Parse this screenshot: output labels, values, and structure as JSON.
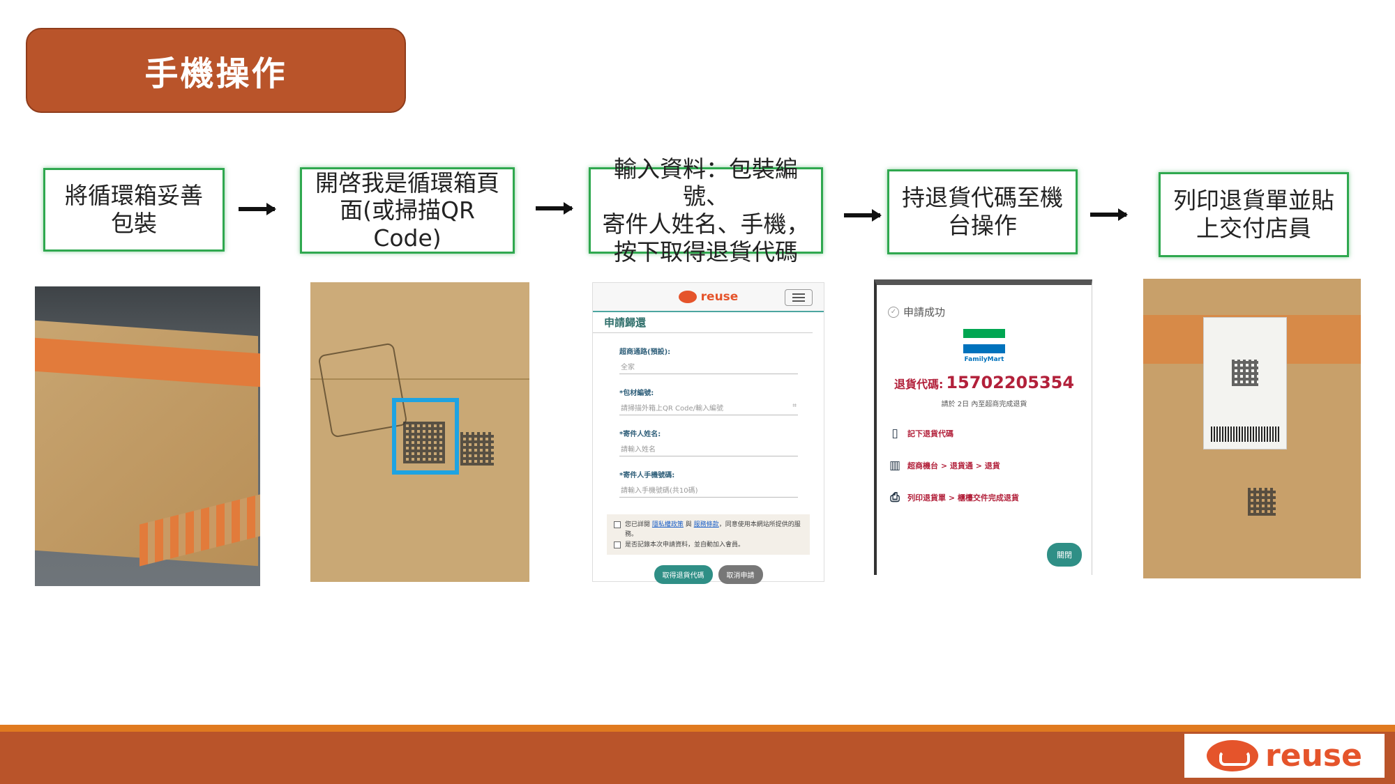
{
  "title": "手機操作",
  "steps": [
    {
      "label": "將循環箱妥善\n包裝"
    },
    {
      "label": "開啓我是循環箱頁\n面(或掃描QR\nCode)"
    },
    {
      "label": "輸入資料：包裝編號、\n寄件人姓名、手機，\n按下取得退貨代碼"
    },
    {
      "label": "持退貨代碼至機\n台操作"
    },
    {
      "label": "列印退貨單並貼\n上交付店員"
    }
  ],
  "form_screen": {
    "brand": "reuse",
    "title": "申請歸還",
    "fields": [
      {
        "label": "超商通路(預設):",
        "placeholder": "全家"
      },
      {
        "label": "*包材編號:",
        "placeholder": "請掃描外箱上QR Code/輸入編號"
      },
      {
        "label": "*寄件人姓名:",
        "placeholder": "請輸入姓名"
      },
      {
        "label": "*寄件人手機號碼:",
        "placeholder": "請輸入手機號碼(共10碼)"
      }
    ],
    "terms_prefix": "您已詳閱",
    "privacy_link": "隱私權政策",
    "terms_and": "與",
    "service_link": "服務條款",
    "terms_suffix": "，同意使用本網站所提供的服務。",
    "remember_text": "是否記錄本次申請資料，並自動加入會員。",
    "submit_button": "取得退貨代碼",
    "cancel_button": "取消申請"
  },
  "success_screen": {
    "status": "申請成功",
    "store_brand": "FamilyMart",
    "code_label": "退貨代碼:",
    "code_value": "15702205354",
    "deadline_note": "請於 2日 內至超商完成退貨",
    "instructions": [
      {
        "icon": "phone-icon",
        "text": "記下退貨代碼"
      },
      {
        "icon": "kiosk-icon",
        "text": "超商機台 > 退貨通 > 退貨"
      },
      {
        "icon": "printer-icon",
        "text": "列印退貨單 > 櫃檯交件完成退貨"
      }
    ],
    "close_button": "關閉"
  },
  "footer": {
    "logo_text": "reuse"
  },
  "colors": {
    "title_bg": "#b9542a",
    "step_border": "#2fa84f",
    "footer_band": "#b9542a",
    "footer_accent": "#e07a1f",
    "brand_orange": "#e5542b",
    "code_red": "#b2203a"
  }
}
